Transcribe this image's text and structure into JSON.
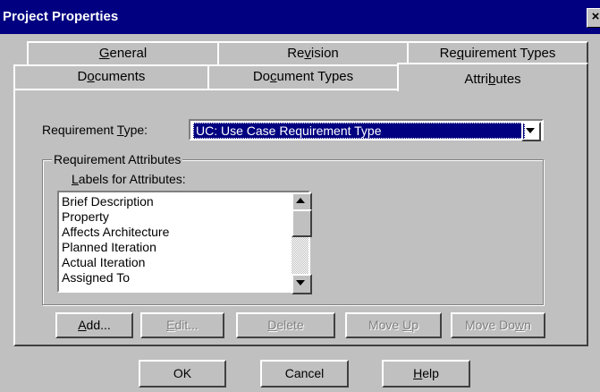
{
  "window": {
    "title": "Project Properties",
    "close_label": "×"
  },
  "tabs": {
    "row_back": [
      {
        "pre": "",
        "key": "G",
        "post": "eneral"
      },
      {
        "pre": "Re",
        "key": "v",
        "post": "ision"
      },
      {
        "pre": "Re",
        "key": "q",
        "post": "uirement Types"
      }
    ],
    "row_front": [
      {
        "pre": "D",
        "key": "o",
        "post": "cuments"
      },
      {
        "pre": "Do",
        "key": "c",
        "post": "ument Types"
      },
      {
        "pre": "Attri",
        "key": "b",
        "post": "utes"
      }
    ],
    "active": "Attributes"
  },
  "requirement_type": {
    "label_pre": "Requirement ",
    "label_key": "T",
    "label_post": "ype:",
    "selected": "UC: Use Case Requirement Type"
  },
  "attributes_group": {
    "title": "Requirement Attributes",
    "labels_pre": "",
    "labels_key": "L",
    "labels_post": "abels for Attributes:",
    "items": [
      "Brief Description",
      "Property",
      "Affects Architecture",
      "Planned Iteration",
      "Actual Iteration",
      "Assigned To"
    ]
  },
  "group_buttons": [
    {
      "pre": "",
      "key": "A",
      "post": "dd...",
      "disabled": false
    },
    {
      "pre": "",
      "key": "E",
      "post": "dit...",
      "disabled": true
    },
    {
      "pre": "",
      "key": "D",
      "post": "elete",
      "disabled": true
    },
    {
      "pre": "Move ",
      "key": "U",
      "post": "p",
      "disabled": true
    },
    {
      "pre": "Move Do",
      "key": "w",
      "post": "n",
      "disabled": true
    }
  ],
  "dialog_buttons": {
    "ok": "OK",
    "cancel": "Cancel",
    "help_pre": "",
    "help_key": "H",
    "help_post": "elp"
  }
}
